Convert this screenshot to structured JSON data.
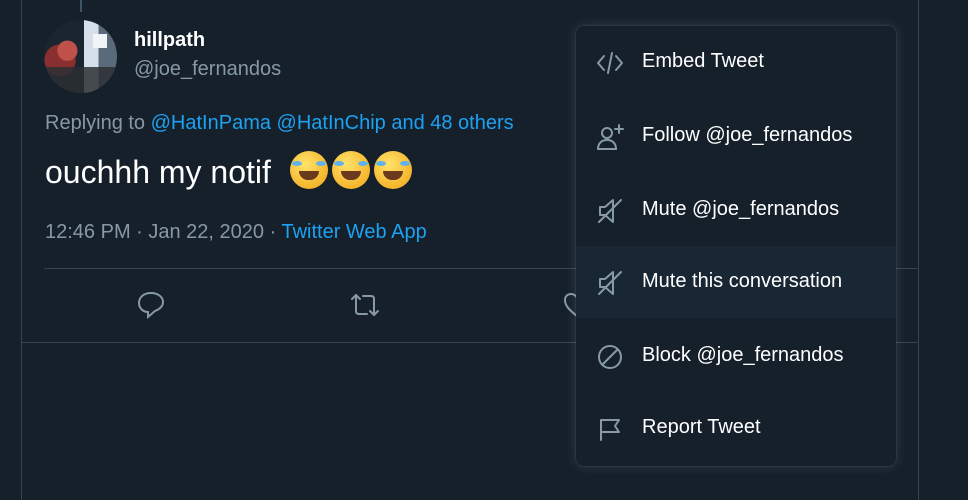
{
  "tweet": {
    "display_name": "hillpath",
    "handle": "@joe_fernandos",
    "replying_prefix": "Replying to",
    "replying_links": "@HatInPama @HatInChip and 48 others",
    "text": "ouchhh my notif",
    "emoji_count": 3,
    "time_date": "12:46 PM · Jan 22, 2020 ·",
    "source": "Twitter Web App"
  },
  "actions": {
    "icons": [
      "reply-icon",
      "retweet-icon",
      "like-icon"
    ]
  },
  "menu": {
    "items": [
      {
        "icon": "code-icon",
        "label": "Embed Tweet"
      },
      {
        "icon": "follow-icon",
        "label": "Follow @joe_fernandos"
      },
      {
        "icon": "mute-icon",
        "label": "Mute @joe_fernandos"
      },
      {
        "icon": "mute-icon",
        "label": "Mute this conversation",
        "highlighted": true
      },
      {
        "icon": "block-icon",
        "label": "Block @joe_fernandos"
      },
      {
        "icon": "flag-icon",
        "label": "Report Tweet"
      }
    ]
  },
  "colors": {
    "background": "#15202b",
    "menu_hover": "#192734",
    "link": "#1da1f2",
    "secondary_text": "#8899a6",
    "border": "#38444d"
  }
}
